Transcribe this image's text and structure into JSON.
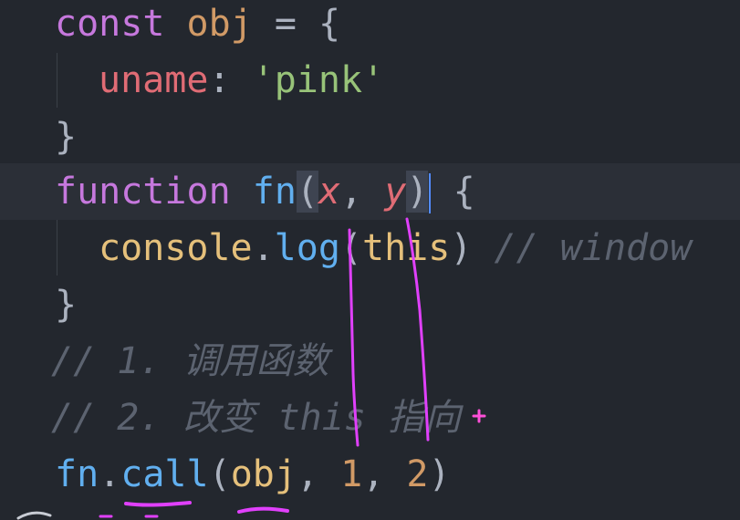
{
  "colors": {
    "keyword": "#c678dd",
    "annotation": "#e040fb",
    "background": "#23272e"
  },
  "code": {
    "line1": {
      "kw": "const",
      "name": "obj",
      "eq": "=",
      "brace": "{"
    },
    "line2": {
      "prop": "uname",
      "colon": ":",
      "value": "'pink'"
    },
    "line3": {
      "brace": "}"
    },
    "line4": {
      "kw": "function",
      "name": "fn",
      "open": "(",
      "p1": "x",
      "comma": ",",
      "p2": "y",
      "close": ")",
      "brace": "{"
    },
    "line5": {
      "obj": "console",
      "dot": ".",
      "method": "log",
      "open": "(",
      "arg": "this",
      "close": ")",
      "comment": "// window"
    },
    "line6": {
      "brace": "}"
    },
    "line7": {
      "comment": "// 1. 调用函数"
    },
    "line8": {
      "comment": "// 2. 改变 this 指向"
    },
    "line9": {
      "obj": "fn",
      "dot": ".",
      "method": "call",
      "open": "(",
      "arg1": "obj",
      "comma1": ",",
      "arg2": "1",
      "comma2": ",",
      "arg3": "2",
      "close": ")"
    }
  }
}
